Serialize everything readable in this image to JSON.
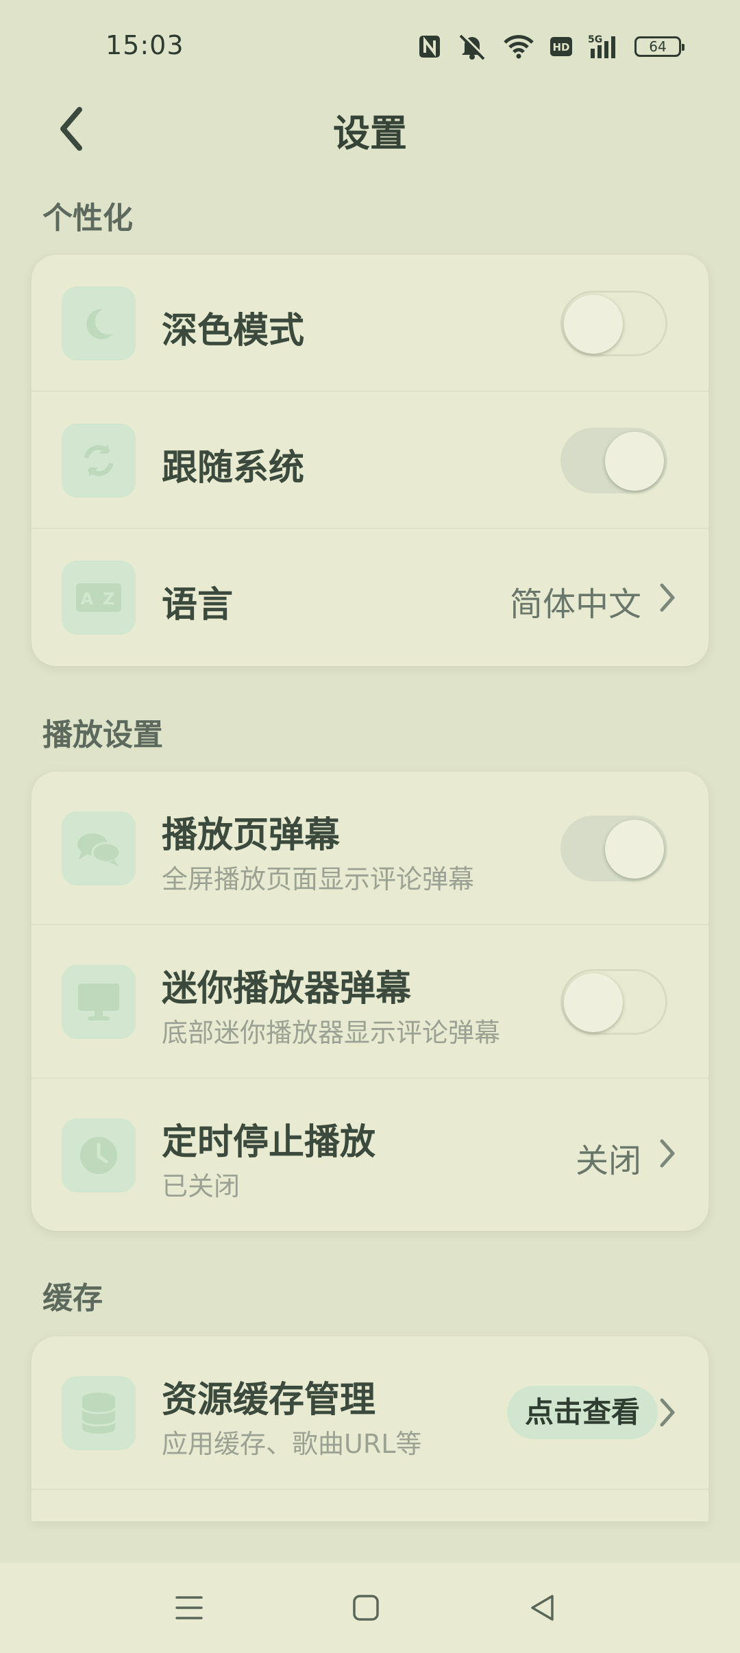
{
  "status": {
    "time": "15:03",
    "battery": "64"
  },
  "header": {
    "title": "设置"
  },
  "sections": {
    "personalization": {
      "title": "个性化",
      "dark_mode": {
        "label": "深色模式",
        "enabled": false
      },
      "follow_system": {
        "label": "跟随系统",
        "enabled": true
      },
      "language": {
        "label": "语言",
        "value": "简体中文"
      }
    },
    "playback": {
      "title": "播放设置",
      "player_danmaku": {
        "label": "播放页弹幕",
        "sub": "全屏播放页面显示评论弹幕",
        "enabled": true
      },
      "mini_danmaku": {
        "label": "迷你播放器弹幕",
        "sub": "底部迷你播放器显示评论弹幕",
        "enabled": false
      },
      "timer": {
        "label": "定时停止播放",
        "sub": "已关闭",
        "value": "关闭"
      }
    },
    "cache": {
      "title": "缓存",
      "resource_cache": {
        "label": "资源缓存管理",
        "sub": "应用缓存、歌曲URL等",
        "action": "点击查看"
      }
    }
  },
  "colors": {
    "accent": "#d3e6cf",
    "icon": "#bfd9bd",
    "background": "#dfe3c9",
    "card": "#e8ebd1"
  },
  "icons": [
    "moon-icon",
    "sync-icon",
    "translate-icon",
    "chat-bubbles-icon",
    "monitor-icon",
    "clock-icon",
    "database-icon"
  ]
}
